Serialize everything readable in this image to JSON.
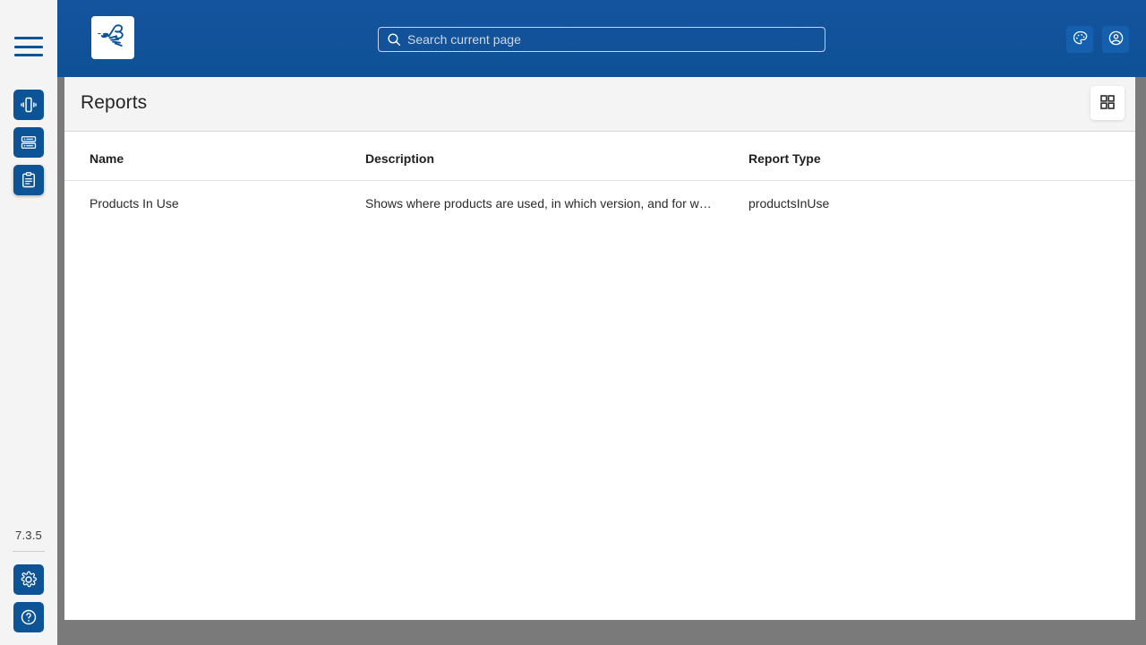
{
  "app": {
    "logo_icon": "bee-logo-icon",
    "version": "7.3.5",
    "accent_color": "#0d5497",
    "header_color": "#15539e",
    "panel_bg": "#ffffff",
    "page_bg": "#7a7a7a"
  },
  "rail": {
    "menu_icon": "hamburger-menu-icon",
    "items": [
      {
        "icon": "device-vibration-icon",
        "active": false
      },
      {
        "icon": "list-server-icon",
        "active": false
      },
      {
        "icon": "clipboard-report-icon",
        "active": true
      }
    ],
    "bottom": [
      {
        "icon": "gear-settings-icon"
      },
      {
        "icon": "help-question-icon"
      }
    ]
  },
  "search": {
    "placeholder": "Search current page",
    "value": "",
    "icon": "search-icon"
  },
  "topbar_actions": [
    {
      "icon": "palette-theme-icon"
    },
    {
      "icon": "account-circle-icon"
    }
  ],
  "page": {
    "title": "Reports",
    "view_toggle_icon": "grid-view-icon"
  },
  "table": {
    "columns": [
      "Name",
      "Description",
      "Report Type"
    ],
    "rows": [
      {
        "name": "Products In Use",
        "description": "Shows where products are used, in which version, and for w…",
        "report_type": "productsInUse"
      }
    ]
  }
}
